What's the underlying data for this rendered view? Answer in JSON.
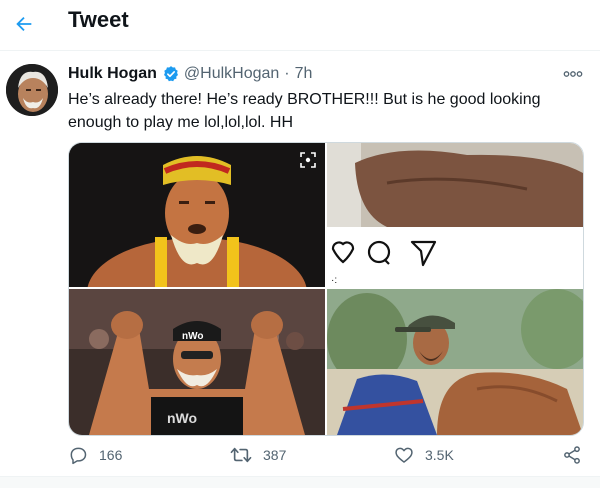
{
  "header": {
    "title": "Tweet",
    "back_icon": "arrow-left-icon",
    "accent": "#1d9bf0"
  },
  "tweet": {
    "display_name": "Hulk Hogan",
    "handle": "@HulkHogan",
    "separator": "·",
    "time": "7h",
    "verified_icon": "verified-badge-icon",
    "text": "He’s already there!  He’s ready BROTHER!!!  But is he good looking enough to play me lol,lol,lol. HH",
    "more_icon": "more-options-icon"
  },
  "media": {
    "photos": [
      {
        "name": "hogan-bandana-photo"
      },
      {
        "name": "flexing-arm-instagram-photo"
      },
      {
        "name": "hogan-flexing-nwo-photo"
      },
      {
        "name": "actor-cap-workout-photo"
      }
    ]
  },
  "actions": {
    "replies": "166",
    "retweets": "387",
    "likes": "3.5K",
    "reply_icon": "reply-icon",
    "retweet_icon": "retweet-icon",
    "like_icon": "heart-icon",
    "share_icon": "share-icon",
    "color": "#536471"
  }
}
